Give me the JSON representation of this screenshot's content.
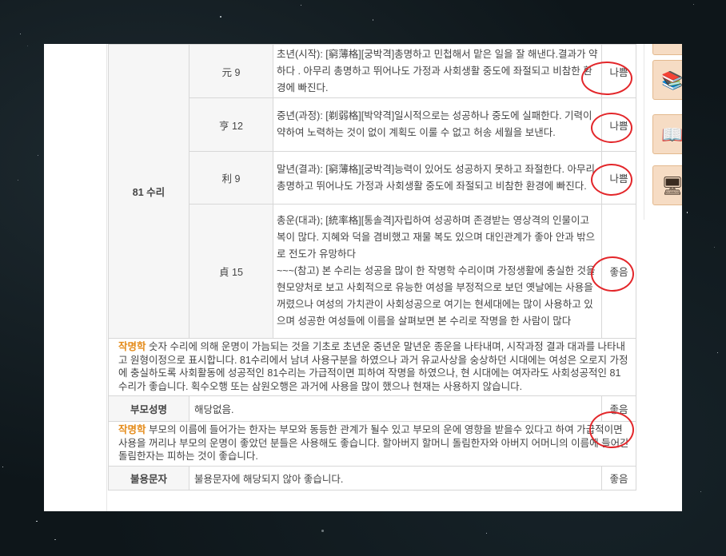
{
  "rows": [
    {
      "value": "元 9",
      "desc": "초년(시작): [窮薄格][궁박격]총명하고 민첩해서 맡은 일을 잘 해낸다.결과가 약하다 . 아무리 총명하고 뛰어나도 가정과 사회생활 중도에 좌절되고 비참한 환경에 빠진다.",
      "verdict": "나쁨"
    },
    {
      "value": "亨 12",
      "desc": "중년(과정): [剃弱格][박약격]일시적으로는 성공하나 중도에 실패한다. 기력이 약하여 노력하는 것이 없이 계획도 이룰 수 없고 허송 세월을 보낸다.",
      "verdict": "나쁨"
    },
    {
      "value": "利 9",
      "desc": "말년(결과): [窮薄格][궁박격]능력이 있어도 성공하지 못하고 좌절한다. 아무리 총명하고 뛰어나도 가정과 사회생활 중도에 좌절되고 비참한 환경에 빠진다.",
      "verdict": "나쁨"
    },
    {
      "value": "貞 15",
      "desc": "총운(대과); [統率格][통솔격]자립하여 성공하며 존경받는 영상격의 인물이고 복이 많다. 지혜와 덕을 겸비했고 재물 복도 있으며 대인관계가 좋아 안과 밖으로 전도가 유망하다\n~~~(참고) 본 수리는 성공을 많이 한 작명학 수리이며 가정생활에 충실한 것을 현모양처로 보고 사회적으로 유능한 여성을 부정적으로 보던 옛날에는 사용을 꺼렸으나 여성의 가치관이 사회성공으로 여기는 현세대에는 많이 사용하고 있으며 성공한 여성들에 이름을 살펴보면 본 수리로 작명을 한 사람이 많다",
      "verdict": "좋음"
    }
  ],
  "group_label": "81 수리",
  "note1": {
    "label": "작명학",
    "text": " 숫자 수리에 의해 운명이 가늠되는 것을 기초로 초년운 중년운 말년운 종운을 나타내며, 시작과정 결과 대과를 나타내고 원형이정으로 표시합니다. 81수리에서 남녀 사용구분을 하였으나 과거 유교사상을 숭상하던 시대에는 여성은 오로지 가정에 충실하도록 사회활동에 성공적인 81수리는 가급적이면 피하여 작명을 하였으나, 현 시대에는 여자라도 사회성공적인 81수리가 좋습니다. 획수오행 또는 삼원오행은 과거에 사용을 많이 했으나 현재는 사용하지 않습니다."
  },
  "parent": {
    "label": "부모성명",
    "value": "해당없음.",
    "verdict": "좋음"
  },
  "note2": {
    "label": "작명학",
    "text": " 부모의 이름에 들어가는 한자는 부모와 동등한 관계가 될수 있고 부모의 운에 영향을 받을수 있다고 하여 가급적이면 사용을 꺼리나 부모의 운명이 좋았던 분들은 사용해도 좋습니다. 할아버지 할머니 돌림한자와 아버지 어머니의 이름에 들어간 돌림한자는 피하는 것이 좋습니다."
  },
  "bullyong": {
    "label": "불용문자",
    "value": "불용문자에 해당되지 않아 좋습니다.",
    "verdict": "좋음"
  },
  "sidebar_icons": [
    "box-icon",
    "books-icon",
    "reading-icon",
    "computer-icon"
  ],
  "colors": {
    "bad": "#e24d3d",
    "good": "#1f45c8",
    "note_label": "#e48b1a",
    "note_text": "#3a5fc4",
    "circle": "#e3262a"
  }
}
